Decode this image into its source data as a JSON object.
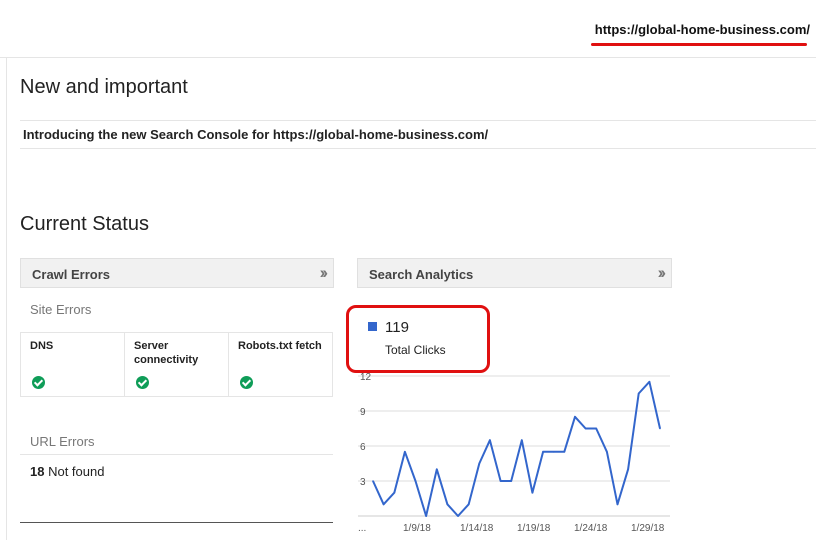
{
  "header": {
    "site_url": "https://global-home-business.com/"
  },
  "new_important": {
    "title": "New and important",
    "announcement": "Introducing the new Search Console for https://global-home-business.com/"
  },
  "current_status": {
    "title": "Current Status",
    "crawl_errors": {
      "title": "Crawl Errors",
      "site_errors_label": "Site Errors",
      "columns": [
        {
          "label": "DNS",
          "status": "ok"
        },
        {
          "label": "Server connectivity",
          "status": "ok"
        },
        {
          "label": "Robots.txt fetch",
          "status": "ok"
        }
      ],
      "url_errors_label": "URL Errors",
      "not_found_count": "18",
      "not_found_label": "Not found"
    },
    "search_analytics": {
      "title": "Search Analytics",
      "total_clicks_value": "119",
      "total_clicks_label": "Total Clicks"
    }
  },
  "colors": {
    "accent_line": "#3366cc",
    "highlight": "#e01010",
    "ok": "#0f9d58"
  },
  "chart_data": {
    "type": "line",
    "series": [
      {
        "name": "Total Clicks",
        "values": [
          3,
          1,
          2,
          5.5,
          3,
          0,
          4,
          1,
          0,
          1,
          4.5,
          6.5,
          3,
          3,
          6.5,
          2,
          5.5,
          5.5,
          5.5,
          8.5,
          7.5,
          7.5,
          5.5,
          1,
          4,
          10.5,
          11.5,
          7.5
        ]
      }
    ],
    "ylim": [
      0,
      12
    ],
    "y_ticks": [
      "3",
      "6",
      "9",
      "12"
    ],
    "x_tick_labels": [
      "...",
      "1/9/18",
      "1/14/18",
      "1/19/18",
      "1/24/18",
      "1/29/18"
    ],
    "grid": true
  }
}
